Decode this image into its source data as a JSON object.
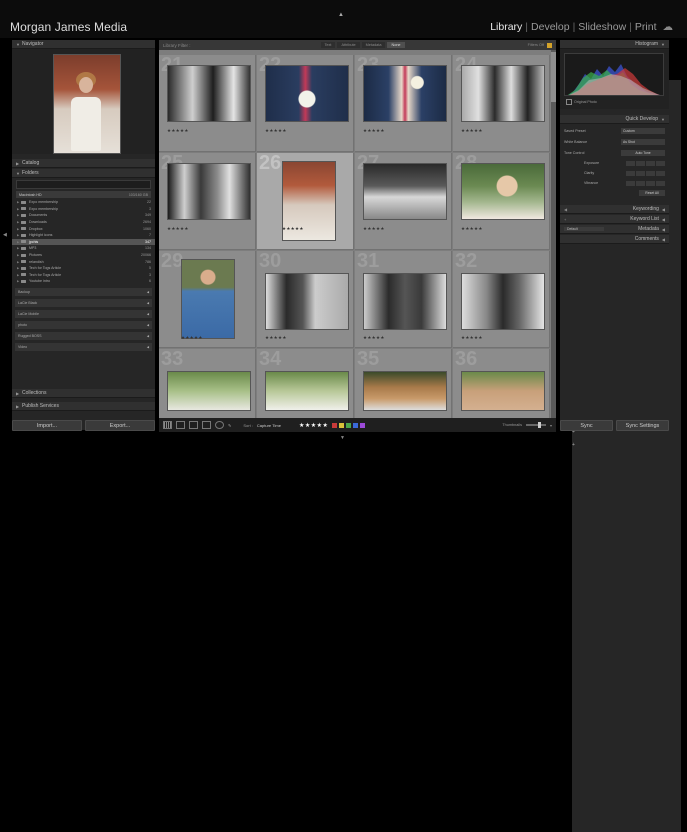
{
  "app": {
    "brand": "Morgan James Media",
    "modules": [
      "Library",
      "Develop",
      "Slideshow",
      "Print"
    ],
    "active_module": "Library",
    "cloud_icon": "cloud-icon"
  },
  "left_panel": {
    "navigator": {
      "title": "Navigator",
      "zoom_options": [
        "FIT",
        "FILL",
        "100%",
        "3:1"
      ]
    },
    "catalog": {
      "title": "Catalog"
    },
    "folders": {
      "title": "Folders",
      "drive": {
        "name": "Macintosh HD",
        "info": "103/160 GB"
      },
      "items": [
        {
          "name": "Expo membership",
          "count": "22"
        },
        {
          "name": "Expo membership",
          "count": "3"
        },
        {
          "name": "Documents",
          "count": "349"
        },
        {
          "name": "Downloads",
          "count": "2694"
        },
        {
          "name": "Dropbox",
          "count": "1060"
        },
        {
          "name": "Highlight icons",
          "count": "7"
        },
        {
          "name": "jpchis",
          "count": "347",
          "selected": true
        },
        {
          "name": "MP3",
          "count": "134"
        },
        {
          "name": "Pictures",
          "count": "20066"
        },
        {
          "name": "relandish",
          "count": "786"
        },
        {
          "name": "Tech for Togs Article",
          "count": "5"
        },
        {
          "name": "Tech for Togs Article",
          "count": "3"
        },
        {
          "name": "Youtube intro",
          "count": "6"
        }
      ],
      "subfolders": [
        "Backup",
        "LaCie Black",
        "LaCie Mobile",
        "photo",
        "Rugged BOSS",
        "Video"
      ]
    },
    "collections": {
      "title": "Collections"
    },
    "publish": {
      "title": "Publish Services"
    },
    "import_label": "Import...",
    "export_label": "Export..."
  },
  "filter_bar": {
    "title": "Library Filter :",
    "tabs": [
      "Text",
      "Attribute",
      "Metadata",
      "None"
    ],
    "active_tab": "None",
    "filters_off": "Filters Off"
  },
  "grid": {
    "cells": [
      {
        "num": "21",
        "stars": "★★★★★"
      },
      {
        "num": "22",
        "stars": "★★★★★"
      },
      {
        "num": "23",
        "stars": "★★★★★"
      },
      {
        "num": "24",
        "stars": "★★★★★"
      },
      {
        "num": "25",
        "stars": "★★★★★"
      },
      {
        "num": "26",
        "stars": "★★★★★",
        "selected": true
      },
      {
        "num": "27",
        "stars": "★★★★★"
      },
      {
        "num": "28",
        "stars": "★★★★★"
      },
      {
        "num": "29",
        "stars": "★★★★★"
      },
      {
        "num": "30",
        "stars": "★★★★★"
      },
      {
        "num": "31",
        "stars": "★★★★★"
      },
      {
        "num": "32",
        "stars": "★★★★★"
      },
      {
        "num": "33",
        "stars": ""
      },
      {
        "num": "34",
        "stars": ""
      },
      {
        "num": "35",
        "stars": ""
      },
      {
        "num": "36",
        "stars": ""
      }
    ]
  },
  "toolbar": {
    "sort_label": "Sort :",
    "sort_value": "Capture Time",
    "rating": "★★★★★",
    "colors": [
      "#c83a3a",
      "#d9c23a",
      "#4aa64a",
      "#3a6ad8",
      "#9c4ad8"
    ],
    "thumbnails_label": "Thumbnails"
  },
  "right_panel": {
    "histogram": {
      "title": "Histogram",
      "original_photo": "Original Photo"
    },
    "quick_develop": {
      "title": "Quick Develop",
      "saved_preset": {
        "label": "Saved Preset",
        "value": "Custom"
      },
      "white_balance": {
        "label": "White Balance",
        "value": "As Shot"
      },
      "tone_control": {
        "label": "Tone Control",
        "value": "Auto Tone"
      },
      "sliders": [
        "Exposure",
        "Clarity",
        "Vibrance"
      ],
      "reset": "Reset All"
    },
    "keywording": {
      "title": "Keywording"
    },
    "keyword_list": {
      "title": "Keyword List"
    },
    "metadata": {
      "title": "Metadata",
      "preset": "Default"
    },
    "comments": {
      "title": "Comments"
    },
    "sync_label": "Sync",
    "sync_settings_label": "Sync Settings"
  }
}
